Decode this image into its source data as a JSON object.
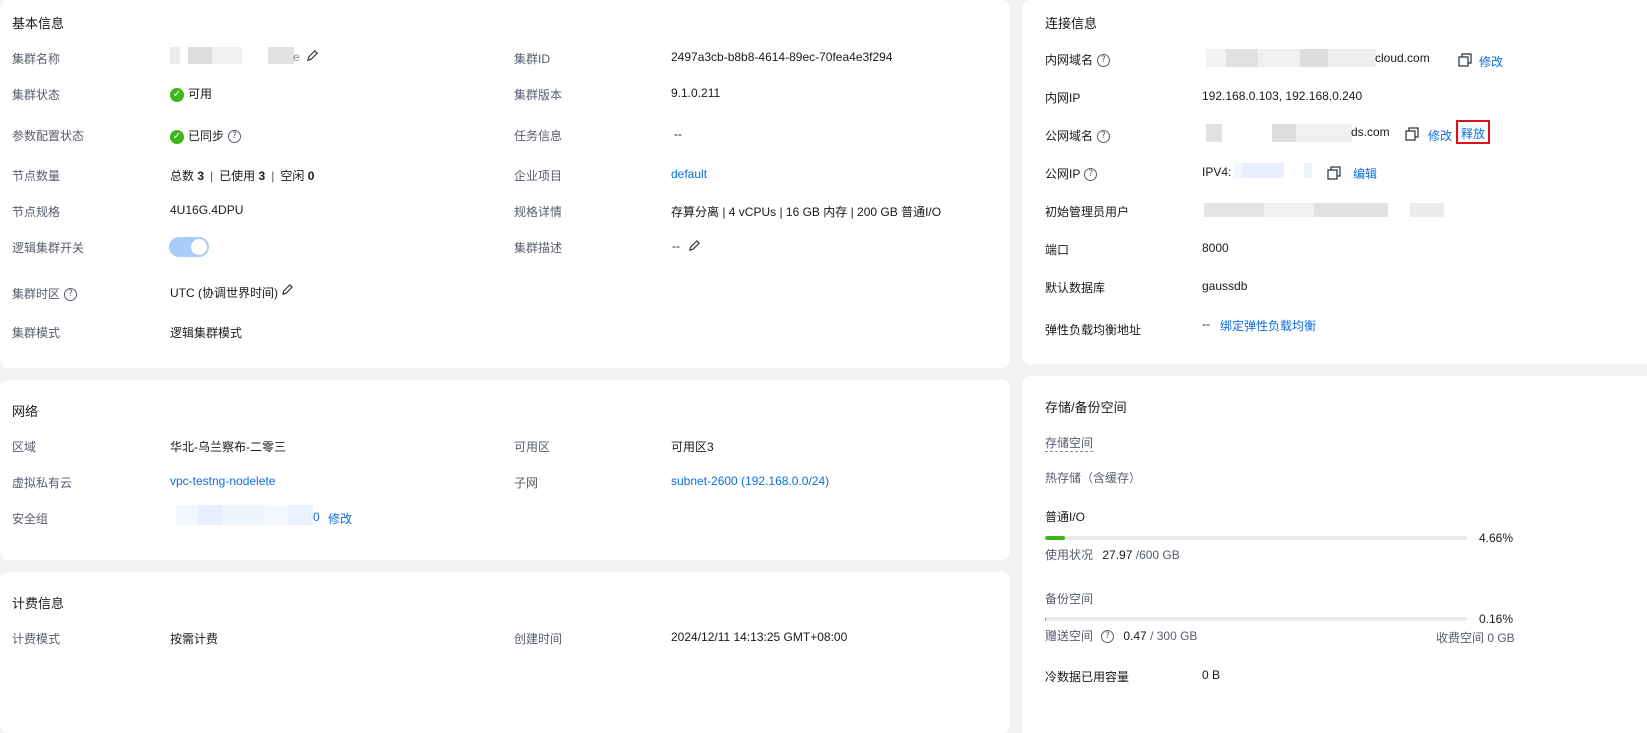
{
  "basic": {
    "title": "基本信息",
    "cluster_name_label": "集群名称",
    "cluster_name_visible_suffix": "e",
    "cluster_status_label": "集群状态",
    "cluster_status_value": "可用",
    "param_status_label": "参数配置状态",
    "param_status_value": "已同步",
    "node_count_label": "节点数量",
    "node_total_label": "总数",
    "node_total": "3",
    "node_used_label": "已使用",
    "node_used": "3",
    "node_idle_label": "空闲",
    "node_idle": "0",
    "node_spec_label": "节点规格",
    "node_spec_value": "4U16G.4DPU",
    "logical_switch_label": "逻辑集群开关",
    "logical_switch_on": true,
    "timezone_label": "集群时区",
    "timezone_value": "UTC (协调世界时间)",
    "mode_label": "集群模式",
    "mode_value": "逻辑集群模式",
    "cluster_id_label": "集群ID",
    "cluster_id_value": "2497a3cb-b8b8-4614-89ec-70fea4e3f294",
    "version_label": "集群版本",
    "version_value": "9.1.0.211",
    "task_label": "任务信息",
    "task_value": "--",
    "enterprise_label": "企业项目",
    "enterprise_value": "default",
    "spec_detail_label": "规格详情",
    "spec_detail_value": "存算分离 | 4 vCPUs | 16 GB 内存 | 200 GB 普通I/O",
    "desc_label": "集群描述",
    "desc_value": "--"
  },
  "network": {
    "title": "网络",
    "region_label": "区域",
    "region_value": "华北-乌兰察布-二零三",
    "vpc_label": "虚拟私有云",
    "vpc_value": "vpc-testng-nodelete",
    "sg_label": "安全组",
    "sg_visible_suffix": "0",
    "sg_modify": "修改",
    "az_label": "可用区",
    "az_value": "可用区3",
    "subnet_label": "子网",
    "subnet_value": "subnet-2600 (192.168.0.0/24)"
  },
  "billing": {
    "title": "计费信息",
    "mode_label": "计费模式",
    "mode_value": "按需计费",
    "created_label": "创建时间",
    "created_value": "2024/12/11 14:13:25 GMT+08:00"
  },
  "connection": {
    "title": "连接信息",
    "private_domain_label": "内网域名",
    "private_domain_suffix": "cloud.com",
    "private_domain_modify": "修改",
    "private_ip_label": "内网IP",
    "private_ip_value": "192.168.0.103, 192.168.0.240",
    "public_domain_label": "公网域名",
    "public_domain_suffix": "ds.com",
    "public_domain_modify": "修改",
    "public_domain_release": "释放",
    "public_ip_label": "公网IP",
    "public_ip_prefix": "IPV4:",
    "public_ip_edit": "编辑",
    "admin_label": "初始管理员用户",
    "port_label": "端口",
    "port_value": "8000",
    "db_label": "默认数据库",
    "db_value": "gaussdb",
    "elb_label": "弹性负载均衡地址",
    "elb_value": "--",
    "elb_bind": "绑定弹性负载均衡"
  },
  "storage": {
    "title": "存储/备份空间",
    "storage_space_label": "存储空间",
    "hot_storage_label": "热存储（含缓存）",
    "normal_io_label": "普通I/O",
    "normal_io_percent": "4.66%",
    "normal_io_fraction": 0.0466,
    "usage_label": "使用状况",
    "usage_used": "27.97",
    "usage_total": "/600 GB",
    "backup_label": "备份空间",
    "backup_percent": "0.16%",
    "backup_fraction": 0.0016,
    "gift_label": "赠送空间",
    "gift_used": "0.47",
    "gift_total": "/ 300 GB",
    "charged_label": "收费空间 0 GB",
    "cold_label": "冷数据已用容量",
    "cold_value": "0 B"
  },
  "colors": {
    "link": "#0d6ee0",
    "success": "#3fb618",
    "highlight_box": "#e0101a"
  }
}
